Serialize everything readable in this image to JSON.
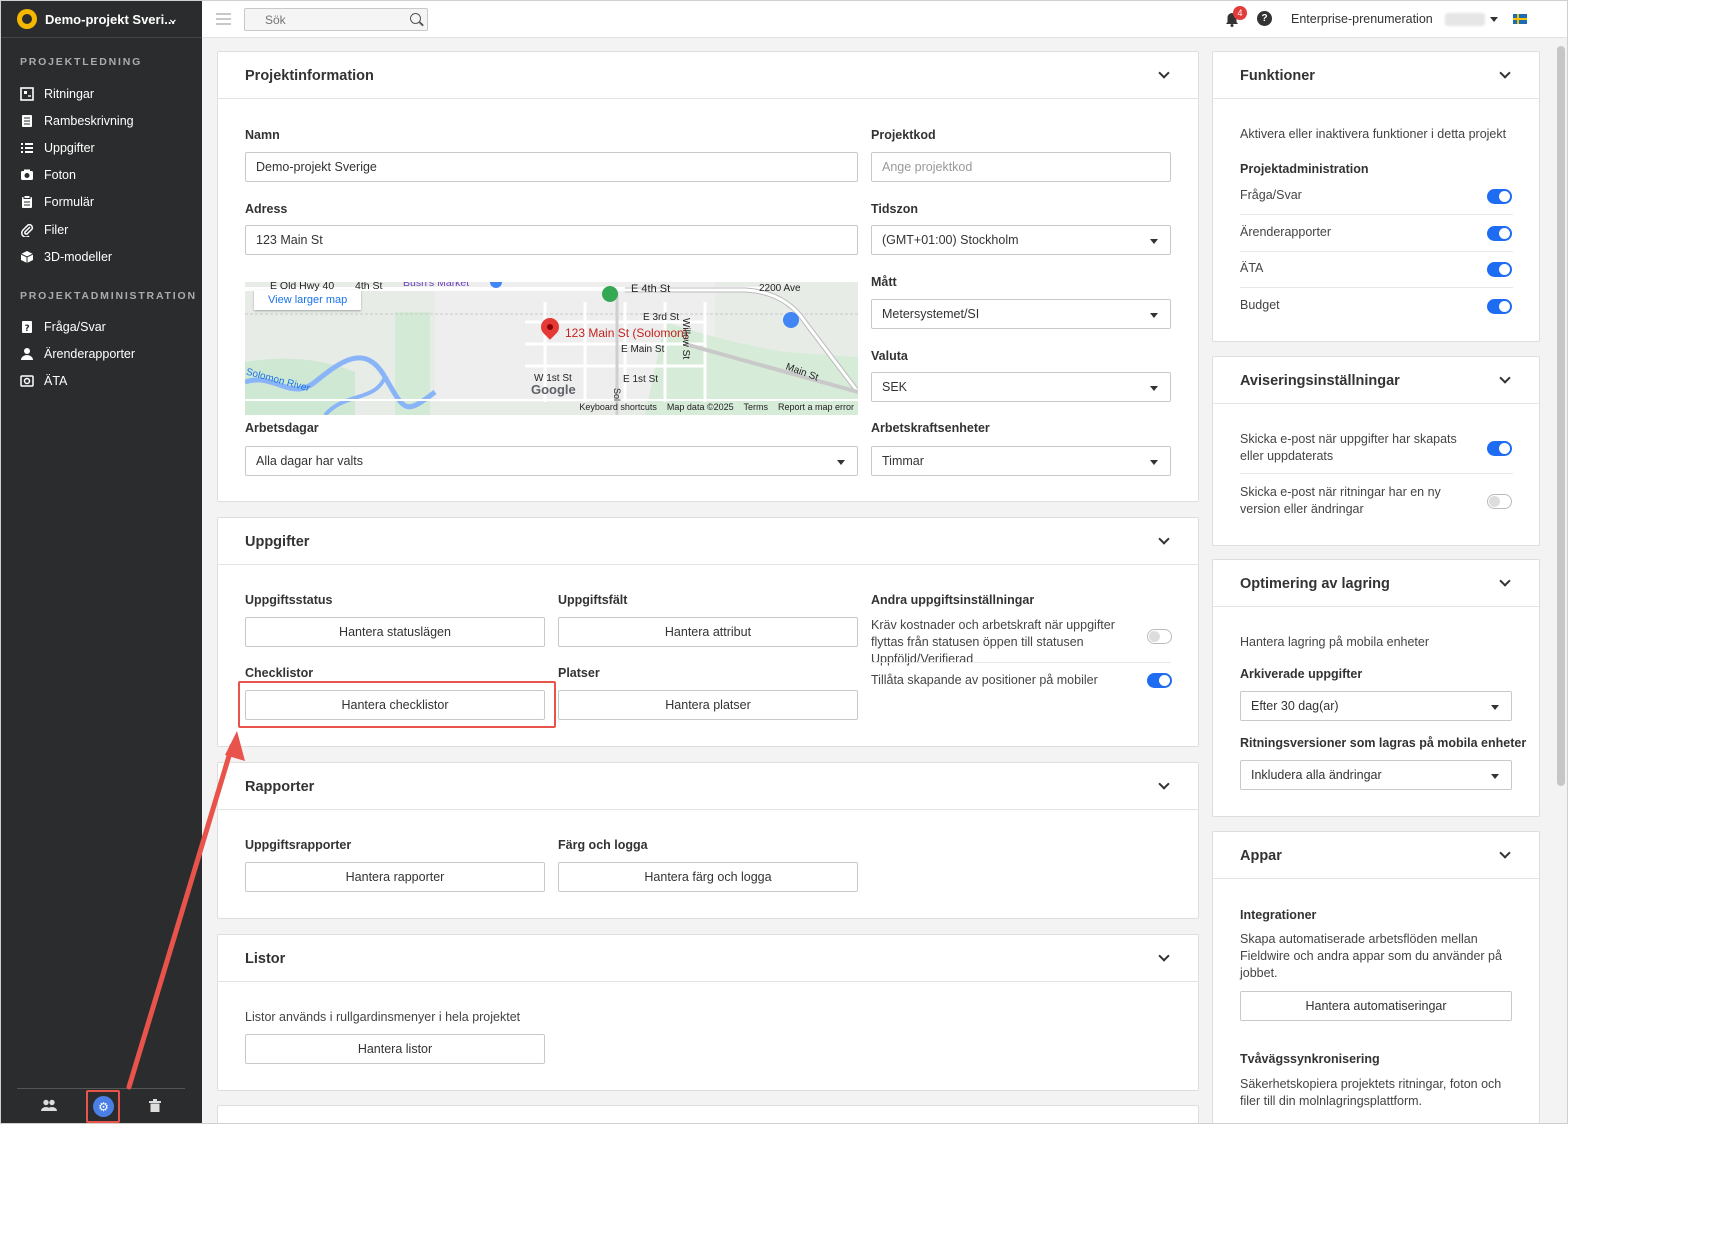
{
  "project": {
    "name": "Demo-projekt Sveri..."
  },
  "sidebar": {
    "section1": "PROJEKTLEDNING",
    "items1": [
      {
        "label": "Ritningar",
        "icon": "drawings-icon"
      },
      {
        "label": "Rambeskrivning",
        "icon": "specs-icon"
      },
      {
        "label": "Uppgifter",
        "icon": "tasks-icon"
      },
      {
        "label": "Foton",
        "icon": "camera-icon"
      },
      {
        "label": "Formulär",
        "icon": "forms-icon"
      },
      {
        "label": "Filer",
        "icon": "paperclip-icon"
      },
      {
        "label": "3D-modeller",
        "icon": "cube-icon"
      }
    ],
    "section2": "PROJEKTADMINISTRATION",
    "items2": [
      {
        "label": "Fråga/Svar",
        "icon": "rfi-icon"
      },
      {
        "label": "Ärenderapporter",
        "icon": "person-icon"
      },
      {
        "label": "ÄTA",
        "icon": "change-order-icon"
      }
    ]
  },
  "topbar": {
    "search_placeholder": "Sök",
    "notifications_count": "4",
    "help": "?",
    "enterprise": "Enterprise-prenumeration"
  },
  "project_info": {
    "title": "Projektinformation",
    "name_label": "Namn",
    "name_value": "Demo-projekt Sverige",
    "code_label": "Projektkod",
    "code_placeholder": "Ange projektkod",
    "address_label": "Adress",
    "address_value": "123 Main St",
    "timezone_label": "Tidszon",
    "timezone_value": "(GMT+01:00) Stockholm",
    "measure_label": "Mått",
    "measure_value": "Metersystemet/SI",
    "currency_label": "Valuta",
    "currency_value": "SEK",
    "workdays_label": "Arbetsdagar",
    "workdays_value": "Alla dagar har valts",
    "labor_label": "Arbetskraftsenheter",
    "labor_value": "Timmar",
    "map": {
      "link": "View larger map",
      "pin_label": "123 Main St (Solomon)",
      "streets": [
        "E Old Hwy 40",
        "4th St",
        "Bush's Market",
        "E 4th St",
        "2200 Ave",
        "E 3rd St",
        "Willow St",
        "E Main St",
        "Main St",
        "W 1st St",
        "E 1st St",
        "Solomon River",
        "Sol"
      ],
      "logo": "Google",
      "footer": [
        "Keyboard shortcuts",
        "Map data ©2025",
        "Terms",
        "Report a map error"
      ]
    }
  },
  "tasks": {
    "title": "Uppgifter",
    "status_label": "Uppgiftsstatus",
    "status_btn": "Hantera statuslägen",
    "fields_label": "Uppgiftsfält",
    "fields_btn": "Hantera attribut",
    "other_label": "Andra uppgiftsinställningar",
    "other_1": "Kräv kostnader och arbetskraft när uppgifter flyttas från statusen öppen till statusen Uppföljd/Verifierad",
    "other_1_on": false,
    "other_2": "Tillåta skapande av positioner på mobiler",
    "other_2_on": true,
    "checklists_label": "Checklistor",
    "checklists_btn": "Hantera checklistor",
    "locations_label": "Platser",
    "locations_btn": "Hantera platser"
  },
  "reports": {
    "title": "Rapporter",
    "task_reports_label": "Uppgiftsrapporter",
    "task_reports_btn": "Hantera rapporter",
    "color_label": "Färg och logga",
    "color_btn": "Hantera färg och logga"
  },
  "lists": {
    "title": "Listor",
    "desc": "Listor används i rullgardinsmenyer i hela projektet",
    "btn": "Hantera listor"
  },
  "functions": {
    "title": "Funktioner",
    "desc": "Aktivera eller inaktivera funktioner i detta projekt",
    "sub": "Projektadministration",
    "items": [
      {
        "label": "Fråga/Svar",
        "on": true
      },
      {
        "label": "Ärenderapporter",
        "on": true
      },
      {
        "label": "ÄTA",
        "on": true
      },
      {
        "label": "Budget",
        "on": true
      }
    ]
  },
  "notifications": {
    "title": "Aviseringsinställningar",
    "item1": "Skicka e-post när uppgifter har skapats eller uppdaterats",
    "item1_on": true,
    "item2": "Skicka e-post när ritningar har en ny version eller ändringar",
    "item2_on": false
  },
  "storage": {
    "title": "Optimering av lagring",
    "desc": "Hantera lagring på mobila enheter",
    "archived_label": "Arkiverade uppgifter",
    "archived_value": "Efter 30 dag(ar)",
    "versions_label": "Ritningsversioner som lagras på mobila enheter",
    "versions_value": "Inkludera alla ändringar"
  },
  "apps": {
    "title": "Appar",
    "integrations_label": "Integrationer",
    "integrations_desc": "Skapa automatiserade arbetsflöden mellan Fieldwire och andra appar som du använder på jobbet.",
    "integrations_btn": "Hantera automatiseringar",
    "sync_label": "Tvåvägssynkronisering",
    "sync_desc": "Säkerhetskopiera projektets ritningar, foton och filer till din molnlagringsplattform."
  },
  "colors": {
    "accent": "#1d6cf2",
    "sidebar": "#2b2c2d",
    "annotation": "#e8544b"
  }
}
